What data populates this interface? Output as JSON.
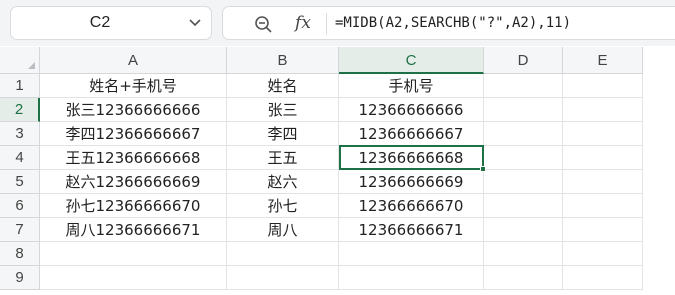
{
  "name_box": {
    "value": "C2"
  },
  "formula_bar": {
    "fx_label": "fx",
    "formula": "=MIDB(A2,SEARCHB(\"?\",A2),11)"
  },
  "columns": [
    "A",
    "B",
    "C",
    "D",
    "E"
  ],
  "rows": [
    "1",
    "2",
    "3",
    "4",
    "5",
    "6",
    "7",
    "8",
    "9"
  ],
  "cells": [
    [
      "姓名+手机号",
      "姓名",
      "手机号",
      "",
      ""
    ],
    [
      "张三12366666666",
      "张三",
      "12366666666",
      "",
      ""
    ],
    [
      "李四12366666667",
      "李四",
      "12366666667",
      "",
      ""
    ],
    [
      "王五12366666668",
      "王五",
      "12366666668",
      "",
      ""
    ],
    [
      "赵六12366666669",
      "赵六",
      "12366666669",
      "",
      ""
    ],
    [
      "孙七12366666670",
      "孙七",
      "12366666670",
      "",
      ""
    ],
    [
      "周八12366666671",
      "周八",
      "12366666671",
      "",
      ""
    ],
    [
      "",
      "",
      "",
      "",
      ""
    ],
    [
      "",
      "",
      "",
      "",
      ""
    ]
  ],
  "selection": {
    "cell": "C2",
    "column": "C",
    "row": "2"
  },
  "colors": {
    "accent": "#1e7145",
    "header_bg": "#f5f6f7",
    "grid_line": "#e1e3e6"
  }
}
